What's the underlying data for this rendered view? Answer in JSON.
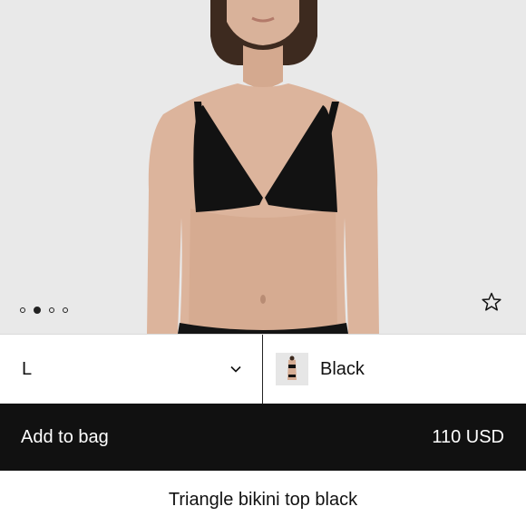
{
  "gallery": {
    "dot_count": 4,
    "active_dot": 1,
    "favorite_icon": "star-icon"
  },
  "size_selector": {
    "selected": "L",
    "icon": "chevron-down-icon"
  },
  "color_selector": {
    "selected": "Black",
    "swatch_icon": "product-thumbnail"
  },
  "add_to_bag": {
    "label": "Add to bag",
    "price": "110 USD"
  },
  "product": {
    "title": "Triangle bikini top black"
  },
  "colors": {
    "background": "#e9e9e9",
    "bar": "#111111",
    "text": "#111111"
  }
}
